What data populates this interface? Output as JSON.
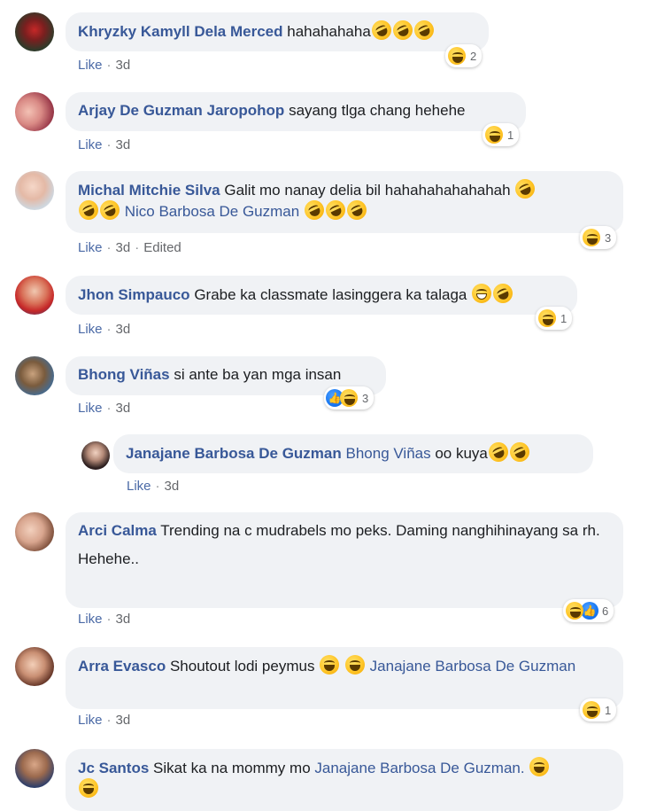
{
  "actions": {
    "like": "Like",
    "time": "3d",
    "edited": "Edited"
  },
  "comments": [
    {
      "author": "Khryzky Kamyll Dela Merced",
      "text": "hahahahaha",
      "react_count": "2"
    },
    {
      "author": "Arjay De Guzman Jaropohop",
      "text": "sayang tlga chang hehehe",
      "react_count": "1"
    },
    {
      "author": "Michal Mitchie Silva",
      "text": "Galit mo nanay delia bil hahahahahahahah",
      "tag": "Nico Barbosa De Guzman",
      "react_count": "3"
    },
    {
      "author": "Jhon Simpauco",
      "text": "Grabe ka classmate lasinggera ka talaga",
      "react_count": "1"
    },
    {
      "author": "Bhong Viñas",
      "text": "si ante ba yan mga insan",
      "react_count": "3"
    },
    {
      "author": "Janajane Barbosa De Guzman",
      "tag": "Bhong Viñas",
      "text": "oo kuya"
    },
    {
      "author": "Arci Calma",
      "text": "Trending na c mudrabels mo peks. Daming nanghihinayang sa rh.",
      "text2": "Hehehe..",
      "react_count": "6"
    },
    {
      "author": "Arra Evasco",
      "text": "Shoutout lodi peymus",
      "tag": "Janajane Barbosa De Guzman",
      "react_count": "1"
    },
    {
      "author": "Jc Santos",
      "text": "Sikat ka na mommy mo",
      "tag": "Janajane Barbosa De Guzman."
    }
  ],
  "colors": {
    "author": "#385898",
    "bubble": "#f0f2f5",
    "meta": "#65676b"
  }
}
